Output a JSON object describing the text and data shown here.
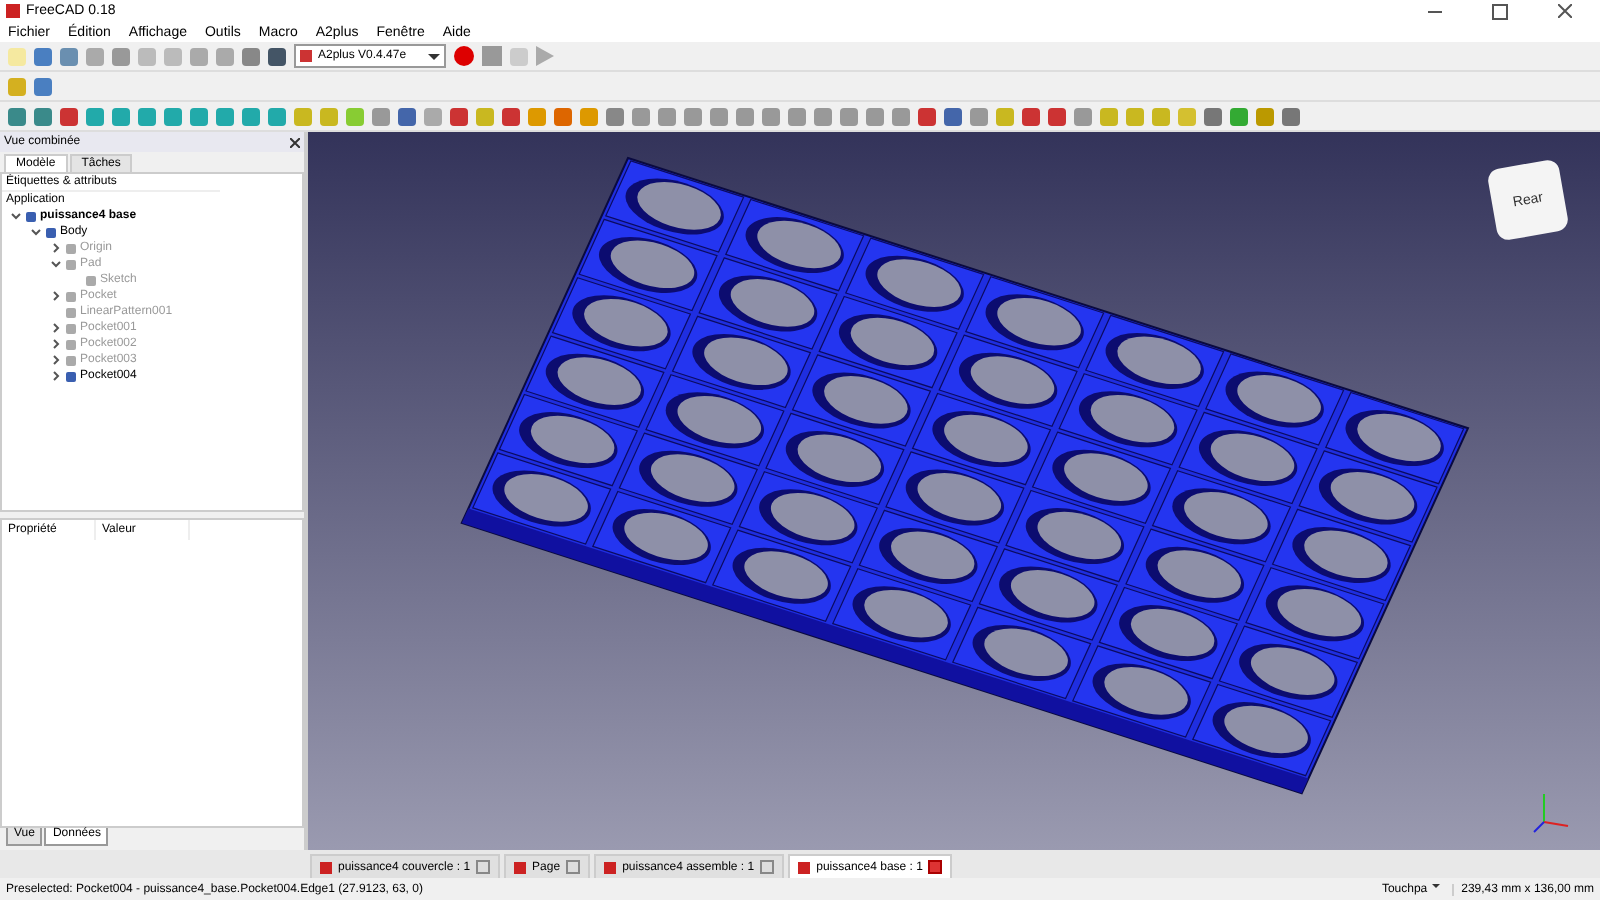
{
  "window": {
    "title": "FreeCAD 0.18"
  },
  "menu": [
    "Fichier",
    "Édition",
    "Affichage",
    "Outils",
    "Macro",
    "A2plus",
    "Fenêtre",
    "Aide"
  ],
  "workbench": {
    "value": "A2plus V0.4.47e"
  },
  "combo_view": {
    "title": "Vue combinée",
    "tabs": [
      {
        "label": "Modèle",
        "selected": true
      },
      {
        "label": "Tâches",
        "selected": false
      }
    ],
    "header": "Étiquettes & attributs",
    "section": "Application",
    "tree": [
      {
        "label": "puissance4 base",
        "visible": true,
        "expanded": true,
        "children": [
          {
            "label": "Body",
            "visible": true,
            "expanded": true,
            "children": [
              {
                "label": "Origin",
                "visible": false,
                "expanded": false
              },
              {
                "label": "Pad",
                "visible": false,
                "expanded": true,
                "children": [
                  {
                    "label": "Sketch",
                    "visible": false
                  }
                ]
              },
              {
                "label": "Pocket",
                "visible": false,
                "expanded": false
              },
              {
                "label": "LinearPattern001",
                "visible": false
              },
              {
                "label": "Pocket001",
                "visible": false,
                "expanded": false
              },
              {
                "label": "Pocket002",
                "visible": false,
                "expanded": false
              },
              {
                "label": "Pocket003",
                "visible": false,
                "expanded": false
              },
              {
                "label": "Pocket004",
                "visible": true,
                "expanded": false
              }
            ]
          }
        ]
      }
    ]
  },
  "properties": {
    "columns": [
      "Propriété",
      "Valeur"
    ],
    "tabs": [
      {
        "label": "Vue",
        "selected": false
      },
      {
        "label": "Données",
        "selected": true
      }
    ]
  },
  "navigation_cube": {
    "face": "Rear"
  },
  "document_tabs": [
    {
      "label": "puissance4 couvercle : 1",
      "selected": false
    },
    {
      "label": "Page",
      "selected": false
    },
    {
      "label": "puissance4 assemble : 1",
      "selected": false
    },
    {
      "label": "puissance4 base : 1",
      "selected": true
    }
  ],
  "status_bar": {
    "message": "Preselected: Pocket004 - puissance4_base.Pocket004.Edge1 (27.9123, 63, 0)",
    "navigation": "Touchpa",
    "dimensions": "239,43 mm x 136,00 mm"
  }
}
